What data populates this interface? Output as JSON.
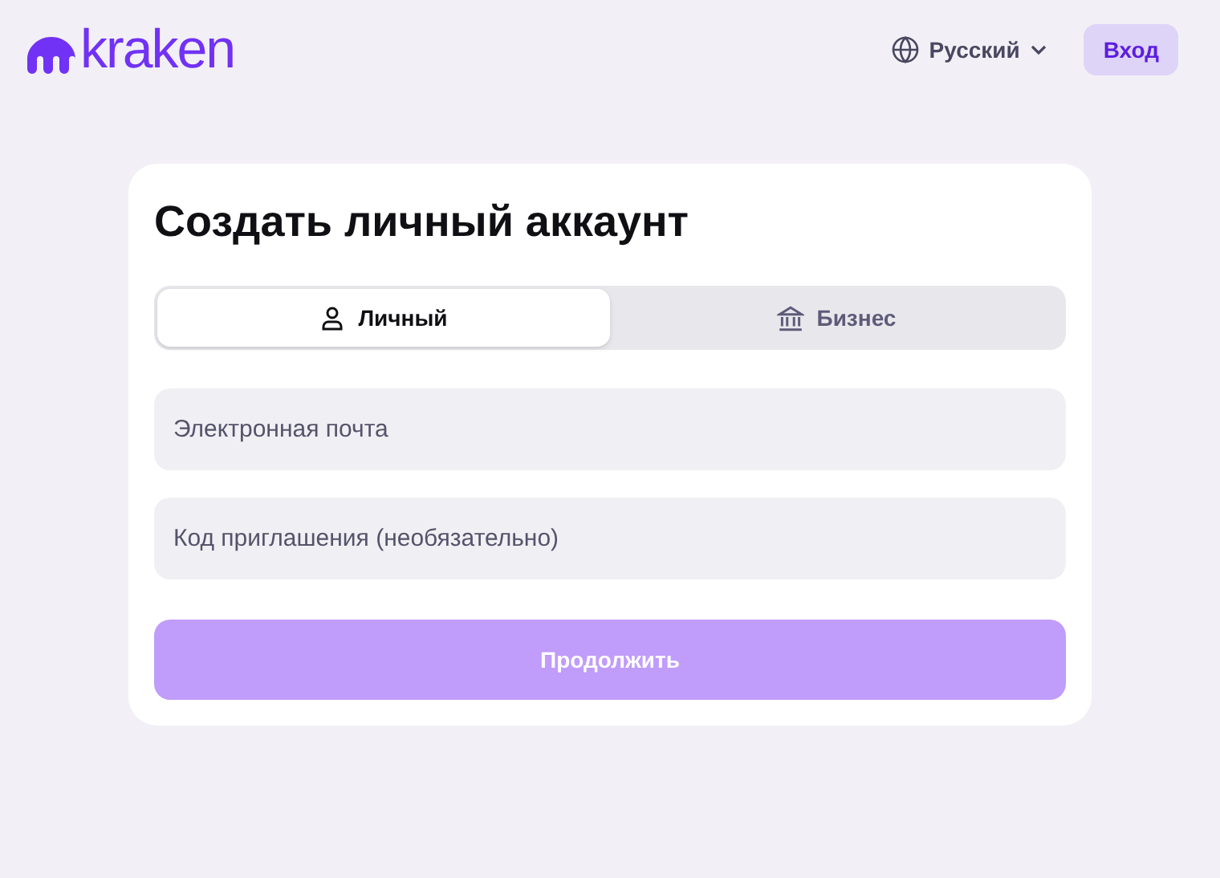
{
  "header": {
    "logo": "kraken",
    "language": "Русский",
    "login_button": "Вход"
  },
  "card": {
    "title": "Создать личный аккаунт",
    "tabs": [
      {
        "label": "Личный",
        "kind": "person",
        "selected": true
      },
      {
        "label": "Бизнес",
        "kind": "bank",
        "selected": false
      }
    ],
    "fields": [
      {
        "placeholder": "Электронная почта"
      },
      {
        "placeholder": "Код приглашения (необязательно)"
      }
    ],
    "submit": {
      "label": "Продолжить",
      "disabled": true
    }
  }
}
